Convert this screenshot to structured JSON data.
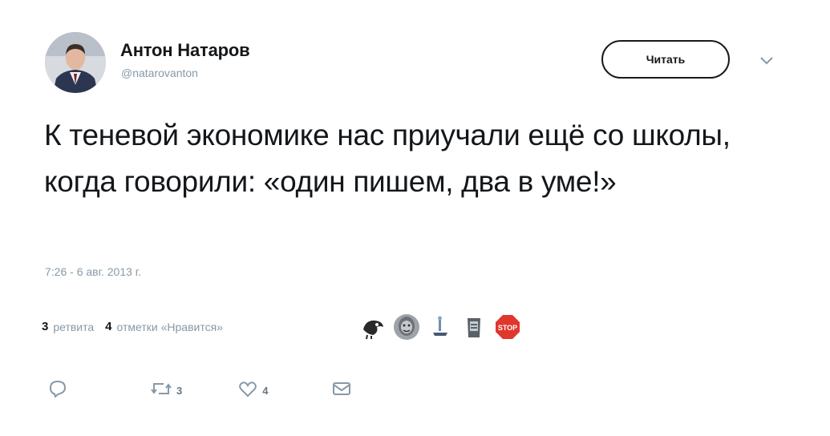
{
  "user": {
    "name": "Антон Натаров",
    "handle": "@natarovanton",
    "follow_label": "Читать"
  },
  "tweet": {
    "text": "К теневой экономике нас приучали ещё со школы, когда говорили: «один пишем, два в уме!»",
    "timestamp": "7:26 - 6 авг. 2013 г."
  },
  "stats": {
    "retweets_count": "3",
    "retweets_label": "ретвита",
    "likes_count": "4",
    "likes_label": "отметки «Нравится»"
  },
  "likers": [
    {
      "icon": "liker-avatar-bird"
    },
    {
      "icon": "liker-avatar-face"
    },
    {
      "icon": "liker-avatar-figure"
    },
    {
      "icon": "liker-avatar-cup"
    },
    {
      "icon": "liker-avatar-stop",
      "text": "STOP"
    }
  ],
  "actions": {
    "reply_count": "",
    "retweet_count": "3",
    "like_count": "4"
  },
  "colors": {
    "text": "#14171a",
    "secondary": "#8899a6",
    "stop_red": "#e0362c"
  }
}
